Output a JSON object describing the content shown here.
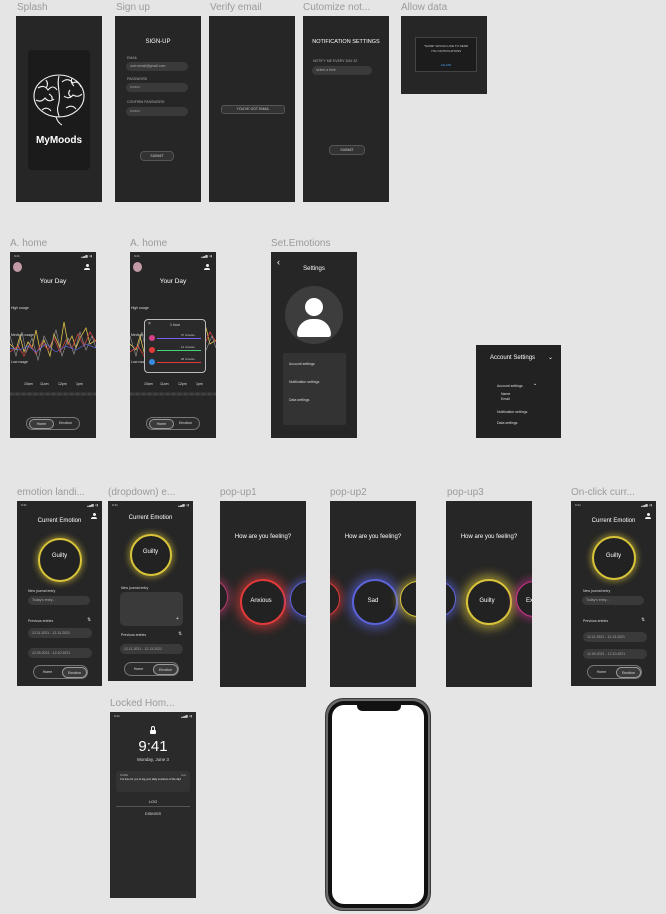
{
  "frames": {
    "splash": {
      "label": "Splash",
      "app_name": "MyMoods"
    },
    "signup": {
      "label": "Sign up",
      "title": "SIGN-UP",
      "email_label": "EMAIL",
      "email_value": "user.email@gmail.com",
      "password_label": "PASSWORD",
      "password_value": "••••••••",
      "confirm_label": "CONFIRM PASSWORD",
      "confirm_value": "••••••••",
      "submit": "SUBMIT"
    },
    "verify": {
      "label": "Verify email",
      "button": "YOU'VE GOT EMAIL"
    },
    "customize": {
      "label": "Cutomize not...",
      "title": "NOTIFICATION SETTINGS",
      "field_label": "NOTIFY ME EVERY DAY AT",
      "field_value": "select a time",
      "submit": "SUBMIT"
    },
    "allow": {
      "label": "Allow data",
      "line1": "\"NAME\" WOULD LIKE TO SEND",
      "line2": "YOU NOTIFICATIONS",
      "link": "ALLOW"
    },
    "home1": {
      "label": "A. home",
      "time": "9:41",
      "title": "Your Day",
      "high": "High usage",
      "medium": "Medium usage",
      "low": "Low usage",
      "ticks": [
        "10am",
        "11am",
        "12pm",
        "1pm"
      ],
      "tab_a": "Home",
      "tab_b": "Emotion"
    },
    "home2": {
      "label": "A. home",
      "time": "9:41",
      "title": "Your Day",
      "high": "High usage",
      "medium": "Medium usage",
      "low": "Low usage",
      "ticks": [
        "10am",
        "11am",
        "12pm",
        "1pm"
      ],
      "popup_time": "1 hour",
      "popup_rows": [
        "37 minutes",
        "12 minutes",
        "28 minutes"
      ],
      "tab_a": "Home",
      "tab_b": "Emotion"
    },
    "settings": {
      "label": "Set.Emotions",
      "title": "Settings",
      "items": [
        "Account settings",
        "Notification settings",
        "Data settings"
      ]
    },
    "account": {
      "title": "Account Settings",
      "sub": "Account settings",
      "name": "Name",
      "email": "Email",
      "notif": "Notification settings",
      "data": "Data settings"
    },
    "emotion": {
      "label": "emotion landi...",
      "time": "9:41",
      "title": "Current Emotion",
      "emotion": "Guilty",
      "new_entry": "New journal entry",
      "new_entry_ph": "Today's entry...",
      "prev": "Previous entries",
      "entries": [
        "12.11.2021 - 12.13.2021",
        "12.09.2021 - 12.10.2021"
      ],
      "tab_a": "Home",
      "tab_b": "Emotion"
    },
    "dropdown": {
      "label": "(dropdown) e...",
      "time": "9:41",
      "title": "Current Emotion",
      "emotion": "Guilty",
      "new_entry": "New journal entry",
      "prev": "Previous entries",
      "entries": [
        "12.11.2021 - 12.13.2021"
      ],
      "tab_a": "Home",
      "tab_b": "Emotion"
    },
    "popup1": {
      "label": "pop-up1",
      "question": "How are you feeling?",
      "emotion": "Anxious"
    },
    "popup2": {
      "label": "pop-up2",
      "question": "How are you feeling?",
      "emotion": "Sad"
    },
    "popup3": {
      "label": "pop-up3",
      "question": "How are you feeling?",
      "emotion": "Guilty",
      "next": "Ex"
    },
    "onclick": {
      "label": "On-click curr...",
      "time": "9:41",
      "title": "Current Emotion",
      "emotion": "Guilty",
      "new_entry": "New journal entry",
      "new_entry_ph": "Today's entry...",
      "prev": "Previous entries",
      "entries": [
        "12.11.2021 - 12.13.2021",
        "12.09.2021 - 12.10.2021"
      ],
      "tab_a": "Home",
      "tab_b": "Emotion"
    },
    "locked": {
      "label": "Locked Hom...",
      "time": "9:41",
      "big_time": "9:41",
      "date": "Monday, June 3",
      "notif_app": "NAME",
      "notif_when": "now",
      "notif_text": "It is time for you to log your daily emotions of the day!",
      "log": "LOG",
      "dismiss": "DISMISS"
    }
  },
  "colors": {
    "bg": "#e5e5e5",
    "frame": "#262626",
    "guilty": "#d9c43a",
    "anxious": "#e03a3a",
    "sad": "#5b63d8",
    "excited": "#c8338a"
  }
}
